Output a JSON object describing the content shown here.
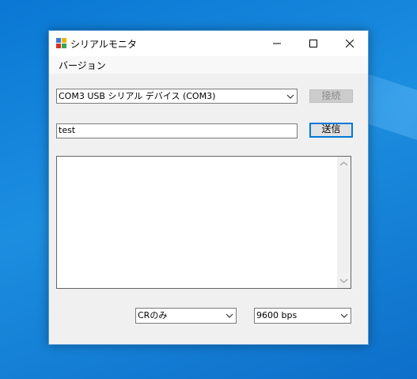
{
  "window": {
    "title": "シリアルモニタ"
  },
  "menu": {
    "items": [
      {
        "label": "バージョン"
      }
    ]
  },
  "port": {
    "selected": "COM3  USB シリアル デバイス (COM3)"
  },
  "connect_button": {
    "label": "接続",
    "enabled": false
  },
  "send": {
    "input_value": "test",
    "button_label": "送信"
  },
  "output": {
    "text": ""
  },
  "line_ending": {
    "selected": "CRのみ"
  },
  "baud_rate": {
    "selected": "9600 bps"
  },
  "icons": {
    "app": "app-icon",
    "minimize": "minimize-icon",
    "maximize": "maximize-icon",
    "close": "close-icon",
    "dropdown": "chevron-down-icon"
  }
}
